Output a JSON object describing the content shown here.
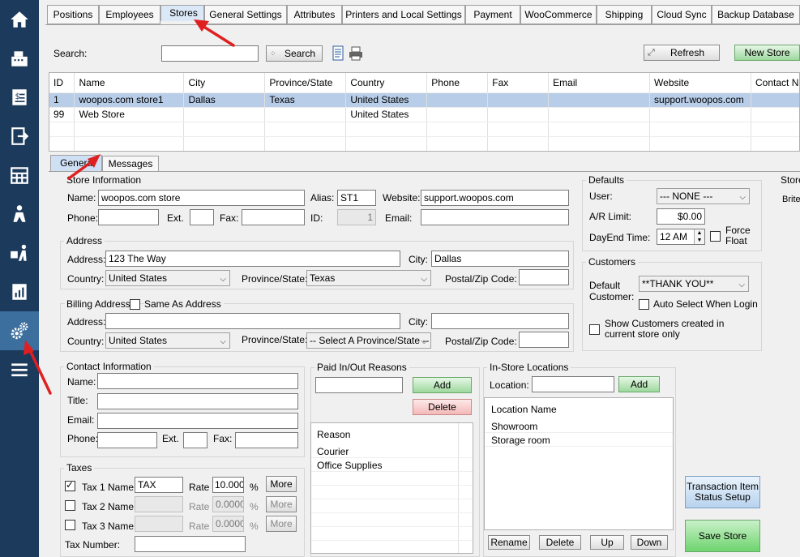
{
  "main_tabs": [
    "Positions",
    "Employees",
    "Stores",
    "General Settings",
    "Attributes",
    "Printers and Local Settings",
    "Payment",
    "WooCommerce",
    "Shipping",
    "Cloud Sync",
    "Backup Database"
  ],
  "toolbar": {
    "search_label": "Search:",
    "search_value": "",
    "search_button": "Search",
    "refresh_button": "Refresh",
    "new_store_button": "New Store"
  },
  "grid": {
    "headers": [
      "ID",
      "Name",
      "City",
      "Province/State",
      "Country",
      "Phone",
      "Fax",
      "Email",
      "Website",
      "Contact Na"
    ],
    "rows": [
      [
        "1",
        "woopos.com store1",
        "Dallas",
        "Texas",
        "United States",
        "",
        "",
        "",
        "support.woopos.com",
        ""
      ],
      [
        "99",
        "Web Store",
        "",
        "",
        "United States",
        "",
        "",
        "",
        "",
        ""
      ]
    ]
  },
  "sub_tabs": [
    "General",
    "Messages"
  ],
  "store_info": {
    "title": "Store Information",
    "name_label": "Name:",
    "name_value": "woopos.com store",
    "alias_label": "Alias:",
    "alias_value": "ST1",
    "website_label": "Website:",
    "website_value": "support.woopos.com",
    "phone_label": "Phone:",
    "ext_label": "Ext.",
    "fax_label": "Fax:",
    "id_label": "ID:",
    "id_value": "1",
    "email_label": "Email:"
  },
  "address": {
    "title": "Address",
    "address_label": "Address:",
    "address_value": "123 The Way",
    "city_label": "City:",
    "city_value": "Dallas",
    "country_label": "Country:",
    "country_value": "United States",
    "province_label": "Province/State:",
    "province_value": "Texas",
    "postal_label": "Postal/Zip Code:"
  },
  "billing": {
    "title": "Billing Address -",
    "same_label": "Same As Address",
    "address_label": "Address:",
    "city_label": "City:",
    "country_label": "Country:",
    "country_value": "United States",
    "province_label": "Province/State:",
    "province_value": "-- Select A Province/State --",
    "postal_label": "Postal/Zip Code:"
  },
  "contact": {
    "title": "Contact Information",
    "name_label": "Name:",
    "title_label": "Title:",
    "email_label": "Email:",
    "phone_label": "Phone:",
    "ext_label": "Ext.",
    "fax_label": "Fax:"
  },
  "taxes": {
    "title": "Taxes",
    "rate_label": "Rate",
    "percent": "%",
    "more": "More",
    "rows": [
      {
        "label": "Tax 1 Name",
        "name": "TAX",
        "rate": "10.000"
      },
      {
        "label": "Tax 2 Name",
        "name": "",
        "rate": "0.0000"
      },
      {
        "label": "Tax 3 Name",
        "name": "",
        "rate": "0.0000"
      }
    ],
    "tax_number_label": "Tax Number:"
  },
  "paid_in_out": {
    "title": "Paid In/Out Reasons",
    "add": "Add",
    "delete": "Delete",
    "header": "Reason",
    "items": [
      "Courier",
      "Office Supplies"
    ]
  },
  "locations": {
    "title": "In-Store Locations",
    "location_label": "Location:",
    "add": "Add",
    "header": "Location Name",
    "items": [
      "Showroom",
      "Storage room"
    ],
    "rename": "Rename",
    "delete": "Delete",
    "up": "Up",
    "down": "Down"
  },
  "defaults": {
    "title": "Defaults",
    "user_label": "User:",
    "user_value": "--- NONE ---",
    "ar_label": "A/R Limit:",
    "ar_value": "$0.00",
    "dayend_label": "DayEnd Time:",
    "dayend_value": "12 AM",
    "force_float": "Force Float"
  },
  "customers": {
    "title": "Customers",
    "default_label": "Default Customer:",
    "default_value": "**THANK YOU**",
    "auto_select": "Auto Select When Login",
    "show_created": "Show Customers created in current store only"
  },
  "right_col": {
    "store_label": "Store",
    "brite_label": "BriteV"
  },
  "transaction_button": "Transaction Item Status Setup",
  "save_button": "Save Store",
  "accent": "#3c6e9e",
  "sidebar_bg": "#1b3a5c",
  "selected_row": "#b8cde8"
}
